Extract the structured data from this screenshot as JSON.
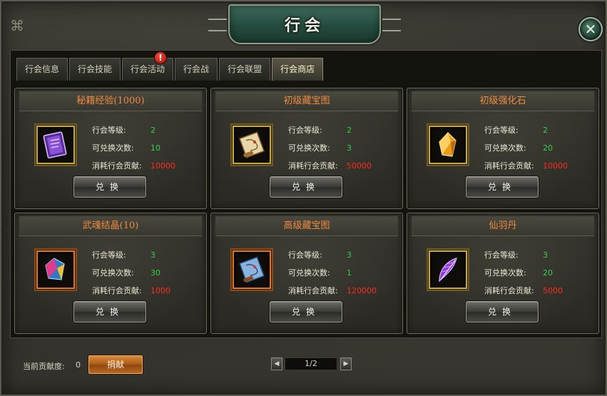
{
  "window": {
    "title": "行会"
  },
  "tabs": [
    {
      "label": "行会信息",
      "active": false,
      "alert": false
    },
    {
      "label": "行会技能",
      "active": false,
      "alert": false
    },
    {
      "label": "行会活动",
      "active": false,
      "alert": true,
      "alert_symbol": "!"
    },
    {
      "label": "行会战",
      "active": false,
      "alert": false
    },
    {
      "label": "行会联盟",
      "active": false,
      "alert": false
    },
    {
      "label": "行会商店",
      "active": true,
      "alert": false
    }
  ],
  "labels": {
    "level": "行会等级:",
    "times": "可兑换次数:",
    "cost": "消耗行会贡献:",
    "exchange": "兑换"
  },
  "items": [
    {
      "name": "秘籍经验(1000)",
      "level": "2",
      "times": "10",
      "cost": "10000",
      "icon": "purple-book-icon",
      "frame": "gold"
    },
    {
      "name": "初级藏宝图",
      "level": "2",
      "times": "3",
      "cost": "50000",
      "icon": "treasure-map-icon",
      "frame": "gold"
    },
    {
      "name": "初级强化石",
      "level": "2",
      "times": "20",
      "cost": "10000",
      "icon": "orange-crystal-icon",
      "frame": "gold"
    },
    {
      "name": "武魂结晶(10)",
      "level": "3",
      "times": "30",
      "cost": "1000",
      "icon": "soul-crystal-icon",
      "frame": "orange"
    },
    {
      "name": "高级藏宝图",
      "level": "3",
      "times": "1",
      "cost": "120000",
      "icon": "advanced-map-icon",
      "frame": "orange"
    },
    {
      "name": "仙羽丹",
      "level": "3",
      "times": "20",
      "cost": "5000",
      "icon": "purple-feather-icon",
      "frame": "gold"
    }
  ],
  "footer": {
    "contribution_label": "当前贡献度:",
    "contribution_value": "0",
    "donate_label": "捐献",
    "page": "1/2"
  },
  "colors": {
    "item_name": "#f08a3c",
    "stat_value": "#31d24a",
    "cost_value": "#ff2a1e"
  }
}
